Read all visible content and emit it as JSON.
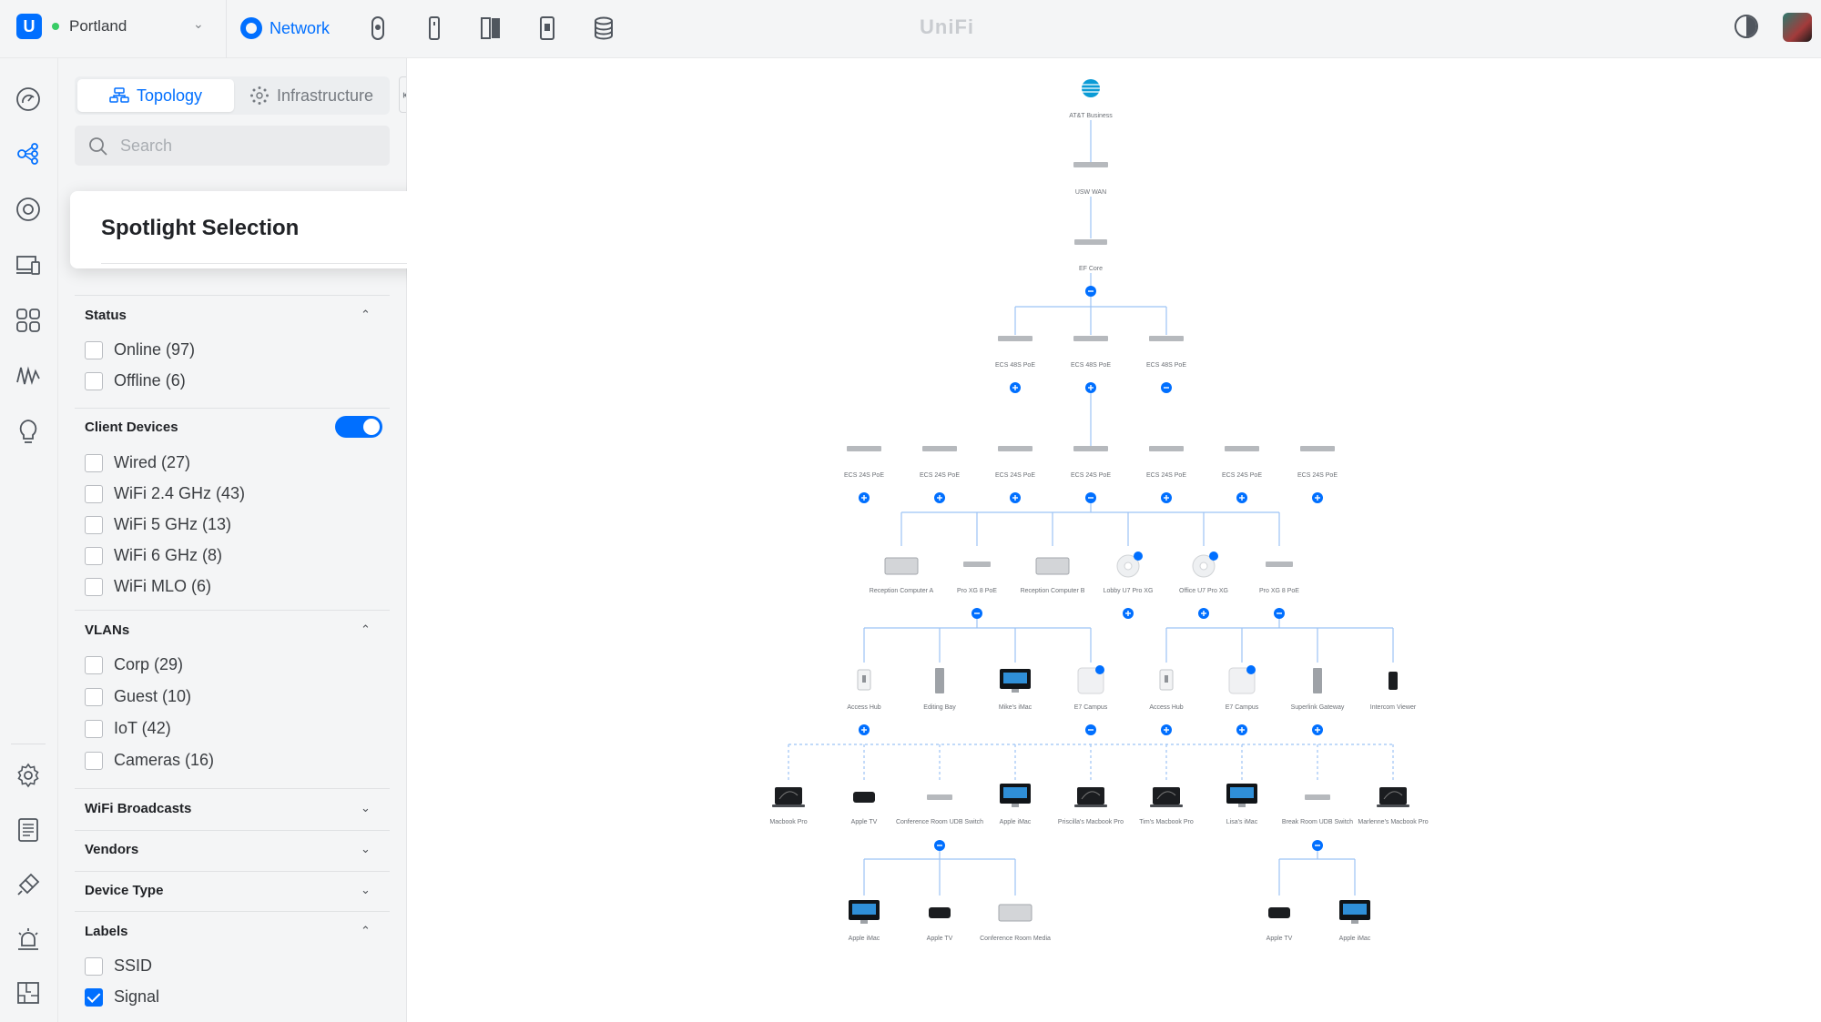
{
  "topbar": {
    "site_name": "Portland",
    "app_tab_label": "Network",
    "brand": "UniFi",
    "app_icons": [
      "protect-icon",
      "access-icon",
      "talk-icon",
      "connect-icon",
      "drive-icon"
    ]
  },
  "rail": {
    "top_icons": [
      "dashboard-icon",
      "topology-icon",
      "devices-icon",
      "client-devices-icon",
      "applications-icon",
      "insights-icon",
      "innerspace-icon"
    ],
    "bottom_icons": [
      "settings-icon",
      "logs-icon",
      "integrations-icon",
      "alarm-icon",
      "floorplan-icon",
      "users-icon"
    ]
  },
  "panel": {
    "tabs": [
      {
        "label": "Topology",
        "icon": "topology-tab-icon",
        "active": true
      },
      {
        "label": "Infrastructure",
        "icon": "infrastructure-tab-icon",
        "active": false
      }
    ],
    "search": {
      "placeholder": "Search",
      "value": ""
    },
    "sections": {
      "status": {
        "title": "Status",
        "items": [
          {
            "label": "Online (97)",
            "checked": false
          },
          {
            "label": "Offline (6)",
            "checked": false
          }
        ]
      },
      "client_devices": {
        "title": "Client Devices",
        "enabled": true,
        "items": [
          {
            "label": "Wired (27)",
            "checked": false
          },
          {
            "label": "WiFi 2.4 GHz (43)",
            "checked": false
          },
          {
            "label": "WiFi 5 GHz (13)",
            "checked": false
          },
          {
            "label": "WiFi 6 GHz (8)",
            "checked": false
          },
          {
            "label": "WiFi MLO (6)",
            "checked": false
          }
        ]
      },
      "vlans": {
        "title": "VLANs",
        "items": [
          {
            "label": "Corp (29)",
            "checked": false
          },
          {
            "label": "Guest (10)",
            "checked": false
          },
          {
            "label": "IoT (42)",
            "checked": false
          },
          {
            "label": "Cameras (16)",
            "checked": false
          }
        ]
      },
      "wifi_broadcasts": {
        "title": "WiFi Broadcasts"
      },
      "vendors": {
        "title": "Vendors"
      },
      "device_type": {
        "title": "Device Type"
      },
      "labels": {
        "title": "Labels",
        "items": [
          {
            "label": "SSID",
            "checked": false
          },
          {
            "label": "Signal",
            "checked": true
          }
        ]
      }
    }
  },
  "popover": {
    "title": "Spotlight Selection",
    "enabled": false
  },
  "topology": {
    "isp": "AT&T Business",
    "wan_switch": "USW WAN",
    "core": "EF Core",
    "tier1": [
      "ECS 48S PoE",
      "ECS 48S PoE",
      "ECS 48S PoE"
    ],
    "tier2": [
      "ECS 24S PoE",
      "ECS 24S PoE",
      "ECS 24S PoE",
      "ECS 24S PoE",
      "ECS 24S PoE",
      "ECS 24S PoE",
      "ECS 24S PoE"
    ],
    "tier3": [
      "Reception Computer A",
      "Pro XG 8 PoE",
      "Reception Computer B",
      "Lobby U7 Pro XG",
      "Office U7 Pro XG",
      "Pro XG 8 PoE"
    ],
    "tier4": [
      "Access Hub",
      "Editing Bay",
      "Mike's iMac",
      "E7 Campus",
      "Access Hub",
      "E7 Campus",
      "Superlink Gateway",
      "Intercom Viewer"
    ],
    "tier5": [
      "Macbook Pro",
      "Apple TV",
      "Conference Room UDB Switch",
      "Apple iMac",
      "Priscilla's Macbook Pro",
      "Tim's Macbook Pro",
      "Lisa's iMac",
      "Break Room UDB Switch",
      "Marlenne's Macbook Pro"
    ],
    "tier6": [
      "Apple iMac",
      "Apple TV",
      "Conference Room Media",
      "Apple TV",
      "Apple iMac"
    ],
    "accent": "#006fff",
    "link_color": "#9cc3f5"
  }
}
